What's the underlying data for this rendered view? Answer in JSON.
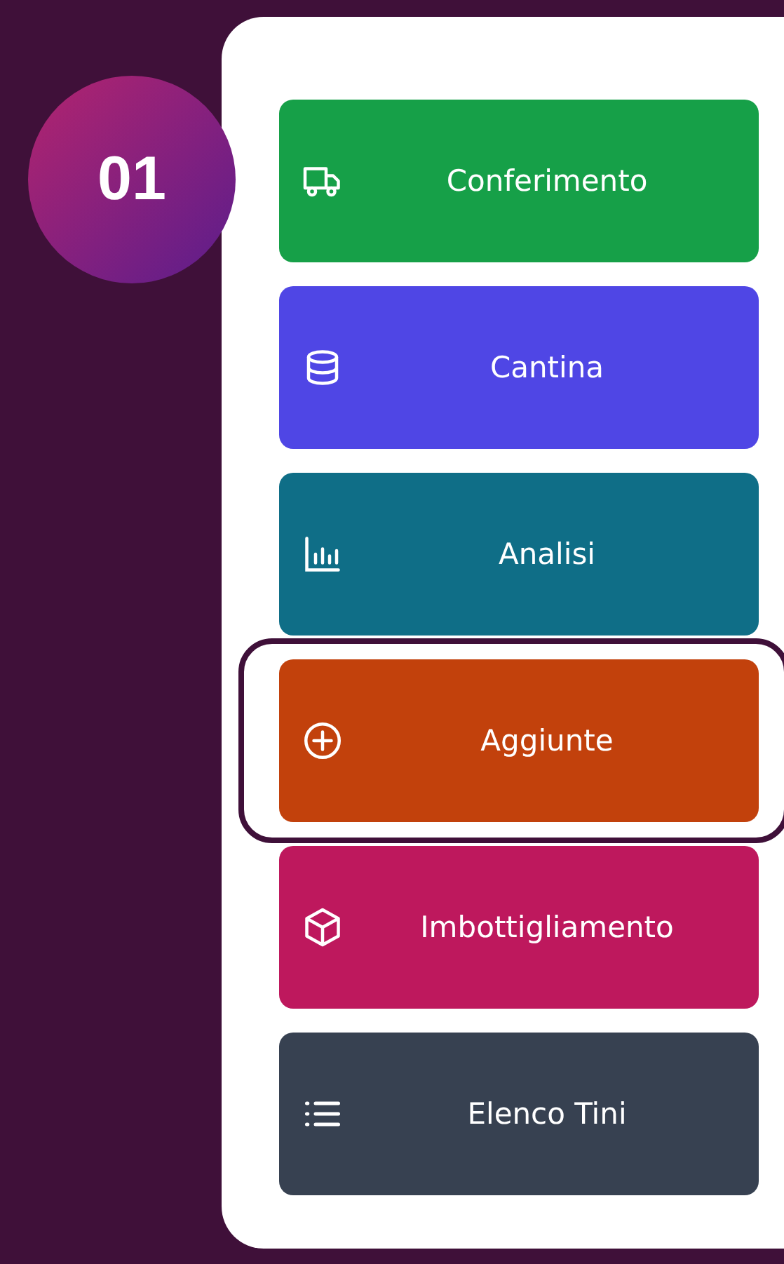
{
  "step_badge": "01",
  "menu": [
    {
      "label": "Conferimento",
      "kind": "truck",
      "color": "#16a048",
      "selected": false
    },
    {
      "label": "Cantina",
      "kind": "database",
      "color": "#4f46e5",
      "selected": false
    },
    {
      "label": "Analisi",
      "kind": "chart",
      "color": "#0f6e87",
      "selected": false
    },
    {
      "label": "Aggiunte",
      "kind": "plus",
      "color": "#c2410c",
      "selected": true
    },
    {
      "label": "Imbottigliamento",
      "kind": "cube",
      "color": "#be185d",
      "selected": false
    },
    {
      "label": "Elenco Tini",
      "kind": "list",
      "color": "#374151",
      "selected": false
    }
  ]
}
